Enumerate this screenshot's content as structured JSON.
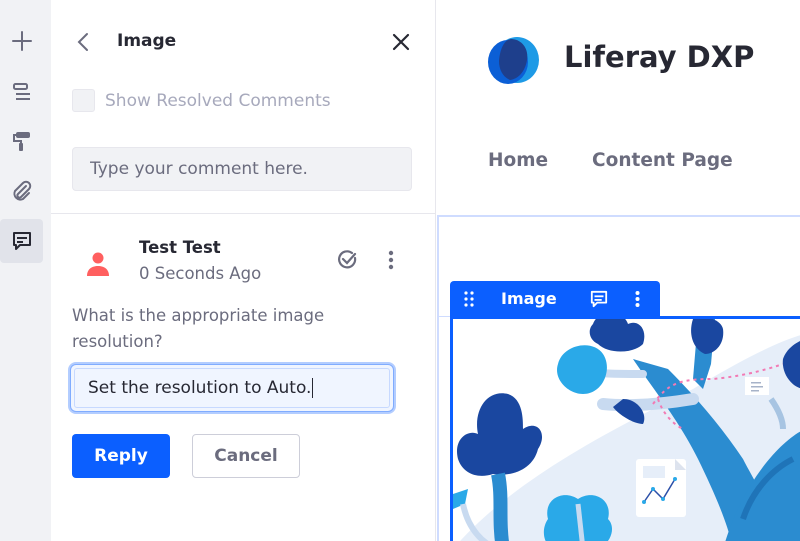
{
  "rail": {
    "items": [
      {
        "name": "add",
        "icon": "plus-icon",
        "active": false
      },
      {
        "name": "page-structure",
        "icon": "page-structure-icon",
        "active": false
      },
      {
        "name": "look-and-feel",
        "icon": "paint-roller-icon",
        "active": false
      },
      {
        "name": "mapping",
        "icon": "paperclip-icon",
        "active": false
      },
      {
        "name": "comments",
        "icon": "comments-icon",
        "active": true
      }
    ]
  },
  "panel": {
    "title": "Image",
    "show_resolved_label": "Show Resolved Comments",
    "show_resolved_checked": false,
    "new_comment_placeholder": "Type your comment here."
  },
  "comment": {
    "author": "Test Test",
    "time": "0 Seconds Ago",
    "body": "What is the appropriate image resolution?",
    "reply_value": "Set the resolution to Auto.",
    "reply_label": "Reply",
    "cancel_label": "Cancel"
  },
  "page": {
    "site_name": "Liferay DXP",
    "nav": [
      "Home",
      "Content Page"
    ],
    "fragment_label": "Image"
  },
  "colors": {
    "primary": "#0b5fff",
    "avatar": "#ff5f5f",
    "text_dark": "#272833",
    "text_secondary": "#6b6c7e"
  }
}
